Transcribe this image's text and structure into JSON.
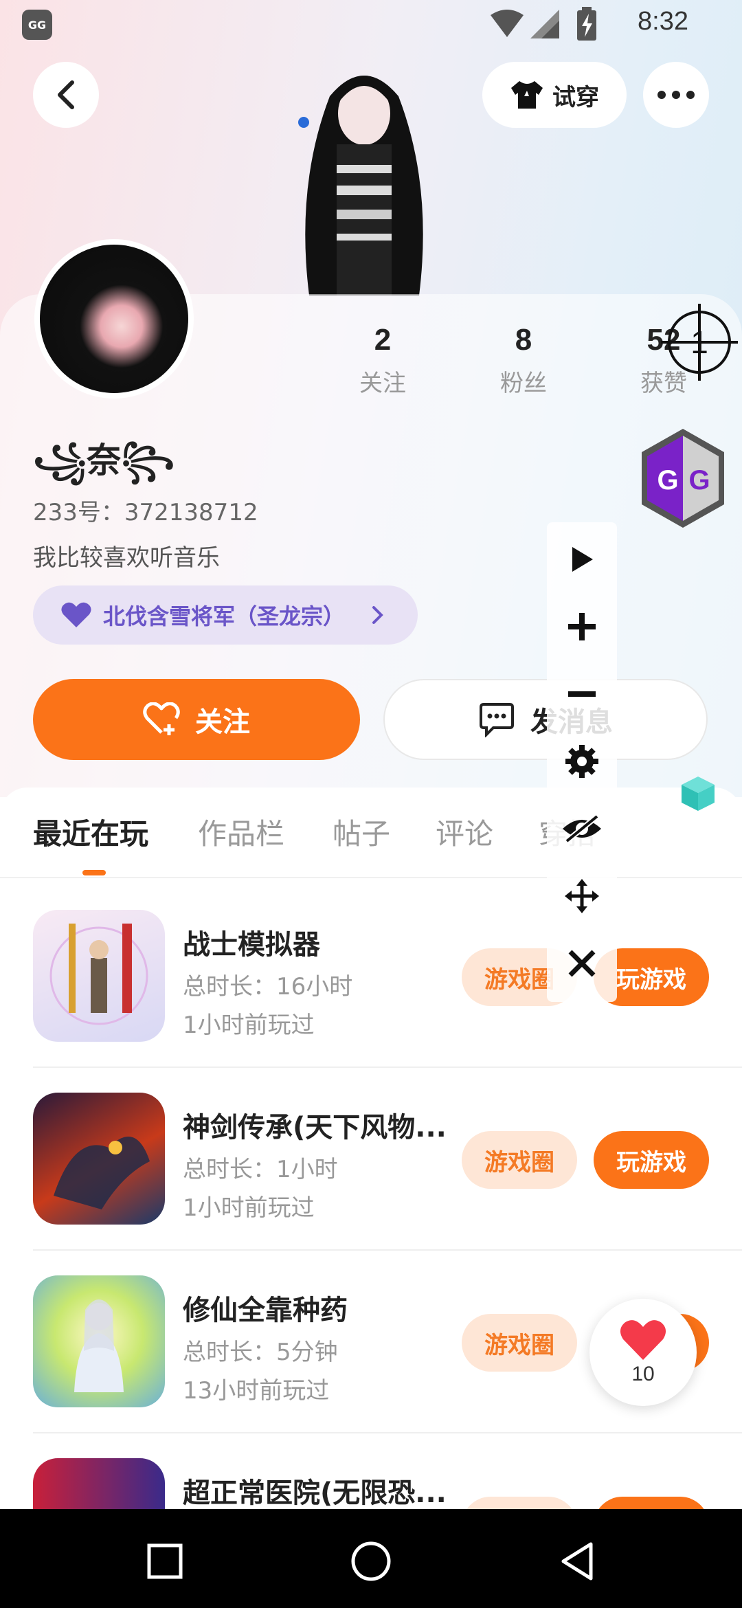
{
  "status_bar": {
    "time": "8:32",
    "app_icon_label": "GG"
  },
  "header": {
    "tryon_label": "试穿"
  },
  "profile": {
    "nickname": "꧁奈꧂",
    "uid": "233号：372138712",
    "bio": "我比较喜欢听音乐",
    "title_badge": "北伐含雪将军（圣龙宗）",
    "stats": [
      {
        "value": "2",
        "label": "关注"
      },
      {
        "value": "8",
        "label": "粉丝"
      },
      {
        "value": "52",
        "label": "获赞"
      }
    ],
    "crosshair_number": "1",
    "follow_label": "关注",
    "message_label": "发消息"
  },
  "tabs": [
    "最近在玩",
    "作品栏",
    "帖子",
    "评论",
    "穿搭"
  ],
  "games": [
    {
      "name": "战士模拟器",
      "duration": "总时长：16小时",
      "last_played": "1小时前玩过",
      "circle_label": "游戏圈",
      "play_label": "玩游戏"
    },
    {
      "name": "神剑传承(天下风物...",
      "duration": "总时长：1小时",
      "last_played": "1小时前玩过",
      "circle_label": "游戏圈",
      "play_label": "玩游戏"
    },
    {
      "name": "修仙全靠种药",
      "duration": "总时长：5分钟",
      "last_played": "13小时前玩过",
      "circle_label": "游戏圈",
      "play_label": "玩游戏"
    },
    {
      "name": "超正常医院(无限恐...",
      "duration": "",
      "last_played": "",
      "circle_label": "",
      "play_label": ""
    }
  ],
  "like_bubble": {
    "count": "10"
  },
  "overlay_gg_badge": "GG",
  "colors": {
    "accent": "#fb7318",
    "purple": "#6a55c8"
  }
}
